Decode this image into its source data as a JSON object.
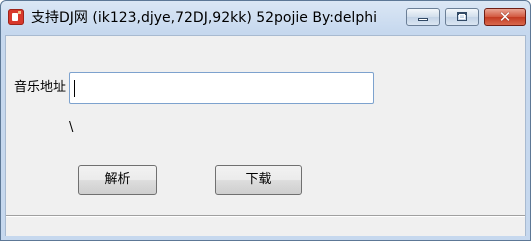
{
  "window": {
    "title": "支持DJ网 (ik123,djye,72DJ,92kk) 52pojie By:delphi",
    "controls": {
      "minimize_icon": "minimize-icon",
      "maximize_icon": "maximize-icon",
      "close_icon": "close-icon",
      "close_glyph": "✕"
    },
    "app_icon": "app-icon"
  },
  "form": {
    "url_label": "音乐地址",
    "url_value": "",
    "status_text": "\\",
    "parse_label": "解析",
    "download_label": "下载"
  },
  "colors": {
    "title_bar": "#c6d8ee",
    "close_button": "#c23a22",
    "client_bg": "#f0f0f0",
    "input_border": "#7da2ce"
  }
}
